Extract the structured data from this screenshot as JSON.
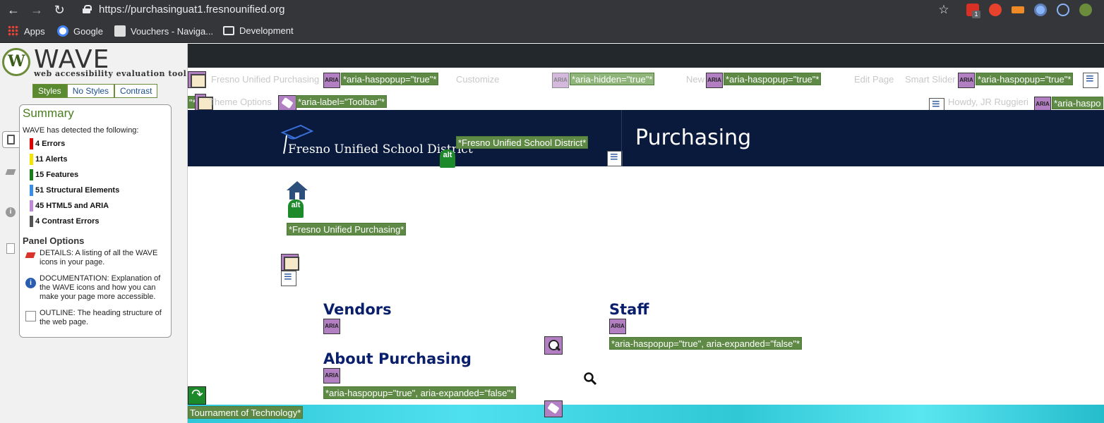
{
  "browser": {
    "url": "https://purchasinguat1.fresnounified.org",
    "bookmarks": [
      {
        "label": "Apps"
      },
      {
        "label": "Google"
      },
      {
        "label": "Vouchers - Naviga..."
      },
      {
        "label": "Development"
      }
    ],
    "extension_badge": "1"
  },
  "wave": {
    "logo_word": "WAVE",
    "subtitle": "web accessibility evaluation tool",
    "tabs": [
      {
        "label": "Styles",
        "active": true
      },
      {
        "label": "No Styles",
        "active": false
      },
      {
        "label": "Contrast",
        "active": false
      }
    ],
    "summary": {
      "title": "Summary",
      "detected": "WAVE has detected the following:",
      "counts": [
        {
          "label": "4 Errors",
          "color": "#e00000"
        },
        {
          "label": "11 Alerts",
          "color": "#f5e400"
        },
        {
          "label": "15 Features",
          "color": "#1a7d1a"
        },
        {
          "label": "51 Structural Elements",
          "color": "#3a8ee6"
        },
        {
          "label": "45 HTML5 and ARIA",
          "color": "#c08ad6"
        },
        {
          "label": "4 Contrast Errors",
          "color": "#555555"
        }
      ],
      "panel_title": "Panel Options",
      "options": [
        {
          "label": "DETAILS: A listing of all the WAVE icons in your page."
        },
        {
          "label": "DOCUMENTATION: Explanation of the WAVE icons and how you can make your page more accessible."
        },
        {
          "label": "OUTLINE: The heading structure of the web page."
        }
      ]
    }
  },
  "page": {
    "admin_bar": {
      "site_name": "Fresno Unified Purchasing",
      "customize": "Customize",
      "new": "New",
      "edit_page": "Edit Page",
      "smart_slider": "Smart Slider",
      "theme_options": "Theme Options",
      "howdy": "Howdy, JR Ruggieri"
    },
    "aria_label": "ARIA",
    "annotations": {
      "haspopup": "*aria-haspopup=\"true\"*",
      "hidden": "*aria-hidden=\"true\"*",
      "toolbar": "*aria-label=\"Toolbar\"*",
      "trunc_right": "*aria-haspo",
      "trunc_left": "\"*",
      "fusd_alt": "*Fresno Unified School District*",
      "purchasing_alt": "*Fresno Unified Purchasing*",
      "haspopup_expanded": "*aria-haspopup=\"true\", aria-expanded=\"false\"*",
      "tournament": "Tournament of Technology*"
    },
    "alt_label": "alt",
    "header": {
      "district_name": "Fresno Unified School District",
      "title": "Purchasing"
    },
    "sections": {
      "vendors": "Vendors",
      "staff": "Staff",
      "about": "About Purchasing"
    }
  }
}
